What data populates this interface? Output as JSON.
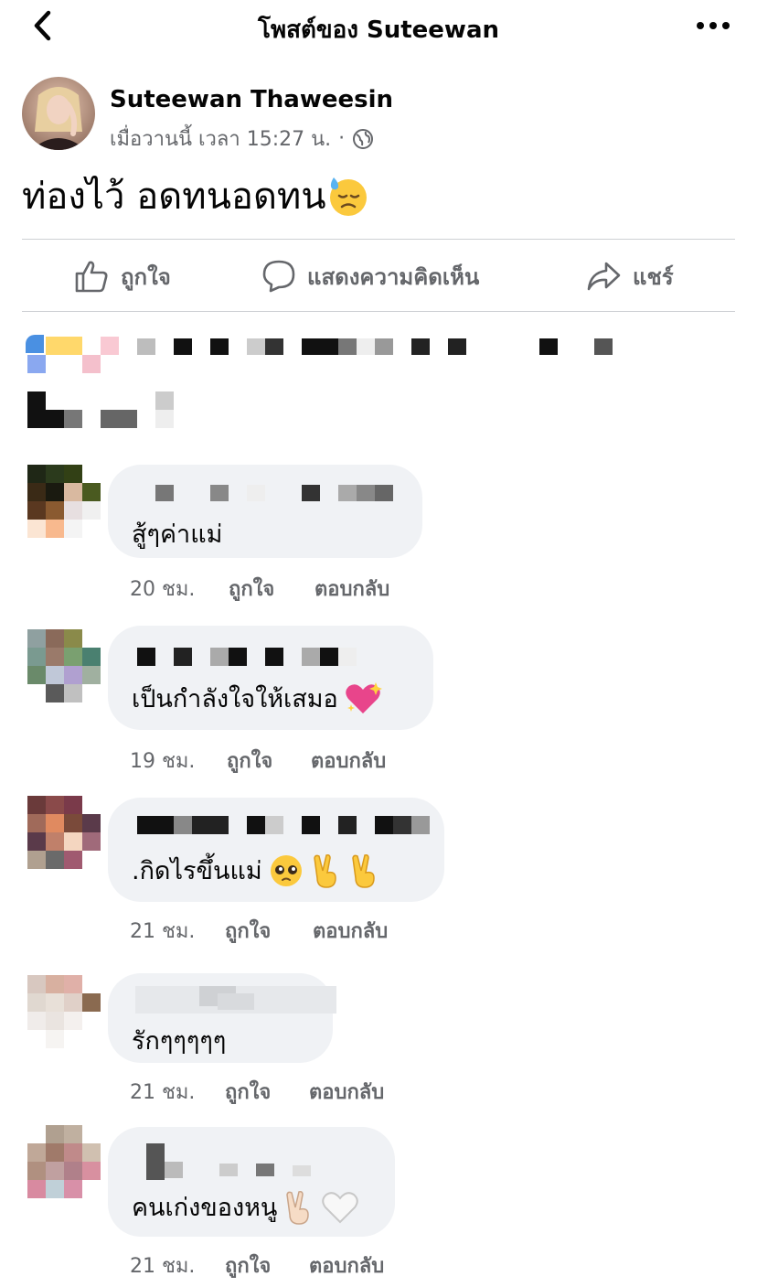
{
  "header": {
    "title": "โพสต์ของ Suteewan"
  },
  "post": {
    "author": "Suteewan Thaweesin",
    "time": "เมื่อวานนี้ เวลา 15:27 น.",
    "separator": "·",
    "text": "ท่องไว้ อดทนอดทน",
    "text_emoji": "downcast-face-with-sweat",
    "privacy_icon": "globe-icon"
  },
  "actions": {
    "like": "ถูกใจ",
    "comment": "แสดงความคิดเห็น",
    "share": "แชร์"
  },
  "comments": [
    {
      "text": "สู้ๆค่าแม่",
      "emojis": [],
      "time": "20 ชม.",
      "like": "ถูกใจ",
      "reply": "ตอบกลับ"
    },
    {
      "text": "เป็นกำลังใจให้เสมอ",
      "emojis": [
        "sparkling-heart"
      ],
      "time": "19 ชม.",
      "like": "ถูกใจ",
      "reply": "ตอบกลับ"
    },
    {
      "text": ".กิดไรขึ้นแม่",
      "emojis": [
        "pleading-face",
        "victory-hand",
        "victory-hand"
      ],
      "time": "21 ชม.",
      "like": "ถูกใจ",
      "reply": "ตอบกลับ"
    },
    {
      "text": "รักๆๆๆๆๆ",
      "emojis": [],
      "time": "21 ชม.",
      "like": "ถูกใจ",
      "reply": "ตอบกลับ"
    },
    {
      "text": "คนเก่งของหนู",
      "emojis": [
        "victory-hand-light",
        "white-heart"
      ],
      "time": "21 ชม.",
      "like": "ถูกใจ",
      "reply": "ตอบกลับ"
    }
  ],
  "colors": {
    "text": "#050505",
    "secondary": "#65676b",
    "bubble": "#f0f2f5",
    "divider": "#ced0d4"
  }
}
